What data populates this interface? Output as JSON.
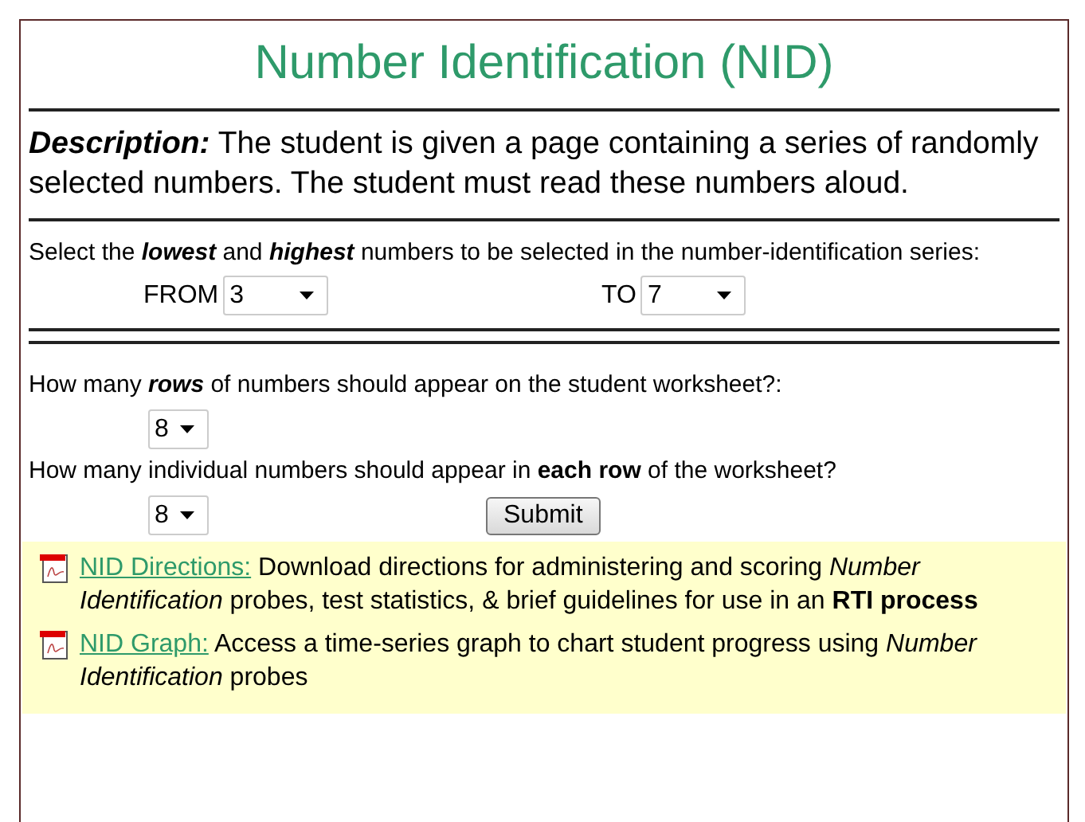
{
  "title": "Number Identification (NID)",
  "description": {
    "label": "Description:",
    "text": "The student is given a page containing a series of randomly selected numbers. The student must read these numbers aloud."
  },
  "range": {
    "prompt": "Select the **lowest** and **highest** numbers to be selected in the number-identification series:",
    "kind": "bolditalic",
    "from": {
      "label": "FROM",
      "value": "3"
    },
    "to": {
      "label": "TO",
      "value": "7"
    }
  },
  "rows": {
    "prompt": "How many **rows** of numbers should appear on the student worksheet?:",
    "kind": "bolditalic",
    "value": "8"
  },
  "per_row": {
    "prompt": "How many individual numbers should appear in **each row** of the worksheet?",
    "kind": "bold",
    "value": "8"
  },
  "submit": "Submit",
  "resources": [
    {
      "link": "NID Directions:",
      "text": "Download directions for administering and scoring *Number Identification* probes, test statistics, & brief guidelines for use in an **RTI process**"
    },
    {
      "link": "NID Graph:",
      "text": "Access a time-series graph to chart student progress using *Number Identification* probes"
    }
  ]
}
